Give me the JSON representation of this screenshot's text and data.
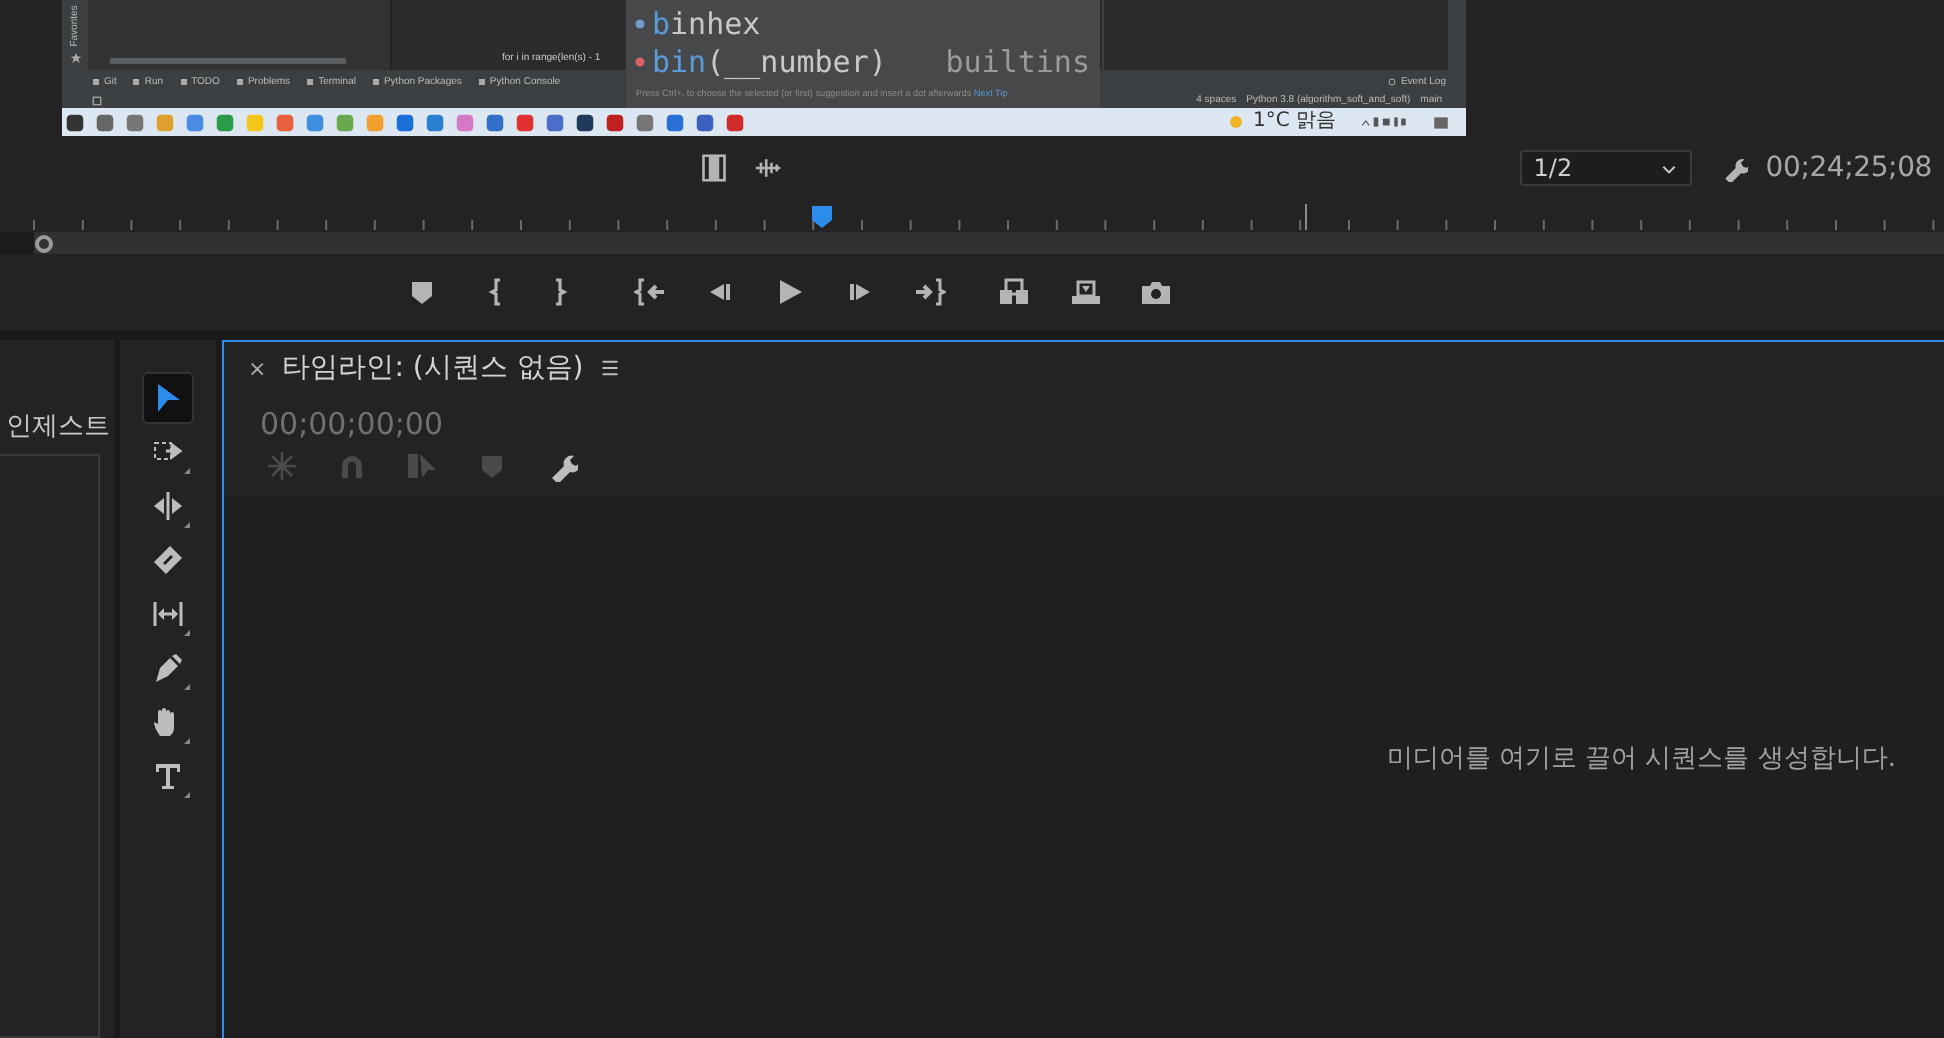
{
  "program_frame": {
    "favorites_label": "Favorites",
    "code_line": "for i in range(len(s) - 1",
    "tool_windows": [
      "Git",
      "Run",
      "TODO",
      "Problems",
      "Terminal",
      "Python Packages",
      "Python Console"
    ],
    "event_log": "Event Log",
    "completion": {
      "items": [
        {
          "match": "b",
          "text": "inhex"
        },
        {
          "match": "bin",
          "text": "(__number)",
          "source": "builtins"
        }
      ],
      "tip": "Press Ctrl+. to choose the selected (or first) suggestion and insert a dot afterwards",
      "tip_link": "Next Tip"
    },
    "status": [
      "4 spaces",
      "Python 3.8 (algorithm_soft_and_soft)",
      "main"
    ],
    "taskbar": {
      "weather": "1°C 맑음"
    }
  },
  "monitor": {
    "zoom": "1/2",
    "timecode": "00;24;25;08",
    "playhead": {
      "level": 0.423
    }
  },
  "side_panel": {
    "title": "인제스트"
  },
  "tools": [
    {
      "selected": true
    },
    {
      "selected": false
    },
    {
      "selected": false
    },
    {
      "selected": false
    },
    {
      "selected": false
    },
    {
      "selected": false
    },
    {
      "selected": false
    },
    {
      "selected": false
    }
  ],
  "timeline": {
    "close": "×",
    "title": "타임라인:",
    "sequence": "(시퀀스 없음)",
    "timecode": "00;00;00;00",
    "tools": [
      {
        "disabled": true
      },
      {
        "disabled": true
      },
      {
        "disabled": true
      },
      {
        "disabled": true
      },
      {
        "disabled": false
      }
    ],
    "empty_message": "미디어를 여기로 끌어 시퀀스를 생성합니다."
  }
}
